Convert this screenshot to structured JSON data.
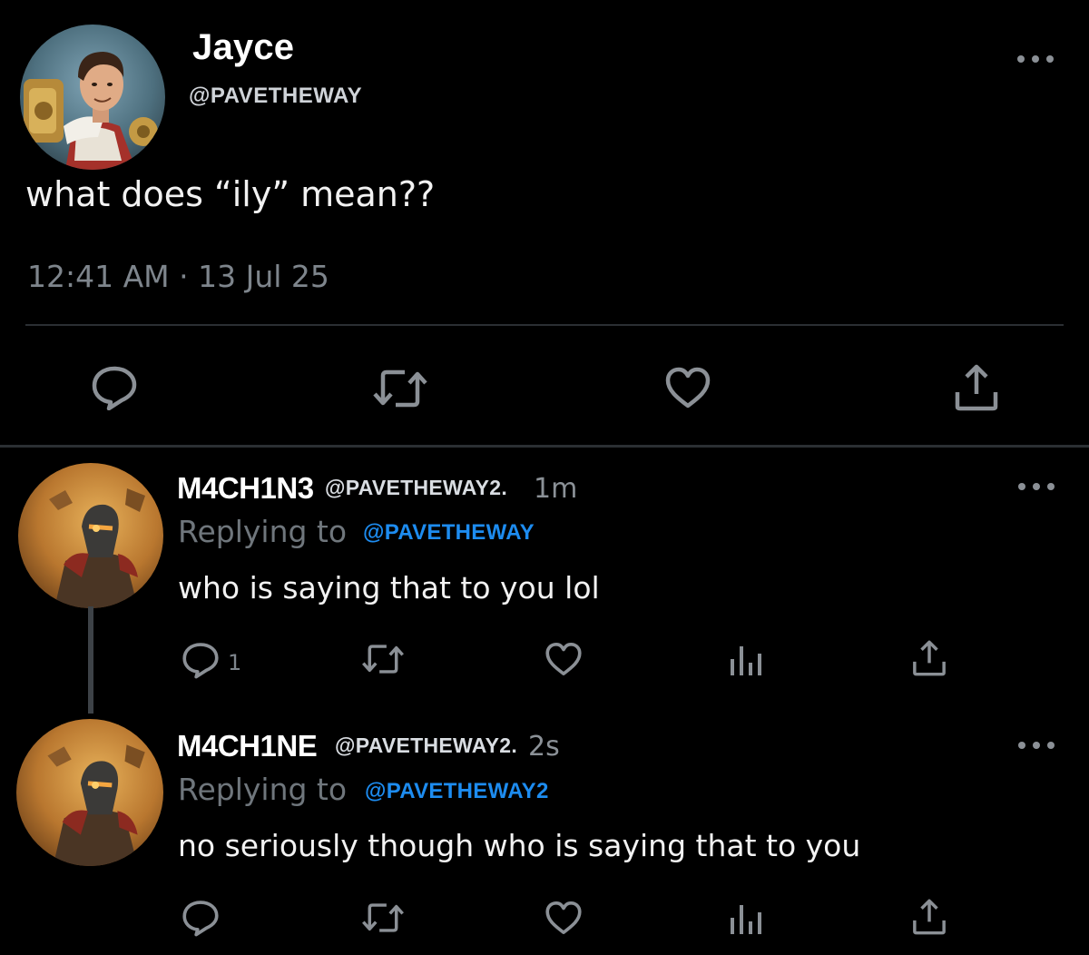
{
  "main_tweet": {
    "display_name": "Jayce",
    "handle": "@PAVETHEWAY",
    "text": "what does “ily” mean??",
    "timestamp": "12:41 AM · 13 Jul 25",
    "avatar_icon": "jayce-avatar",
    "actions": [
      "reply-icon",
      "retweet-icon",
      "like-icon",
      "share-icon"
    ]
  },
  "replies": [
    {
      "display_name": "M4CH1N3",
      "handle": "@PAVETHEWAY2.",
      "time": "1m",
      "replying_label": "Replying to",
      "replying_to": "@PAVETHEWAY",
      "text": "who is saying that to you lol",
      "reply_count": "1",
      "avatar_icon": "machine-herald-avatar"
    },
    {
      "display_name": "M4CH1NE",
      "handle": "@PAVETHEWAY2.",
      "time": "2s",
      "replying_label": "Replying to",
      "replying_to": "@PAVETHEWAY2",
      "text": "no seriously though who is saying that to you",
      "avatar_icon": "machine-herald-avatar"
    }
  ],
  "colors": {
    "background": "#000000",
    "icon_gray": "#8b9096",
    "mention_blue": "#1d8cf0",
    "muted_text": "#7e858c"
  }
}
